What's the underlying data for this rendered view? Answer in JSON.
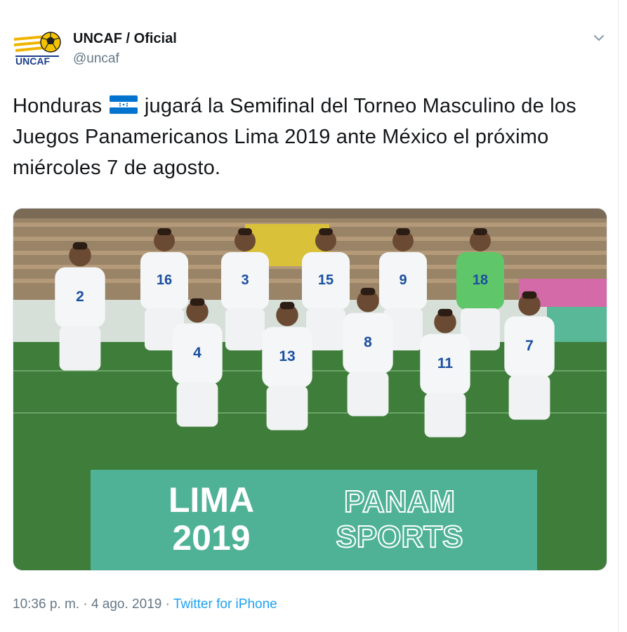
{
  "tweet": {
    "author_name": "UNCAF / Oficial",
    "author_handle": "@uncaf",
    "logo_text": "UNCAF",
    "text_before_flag": "Honduras",
    "text_after_flag": "jugará la Semifinal del Torneo Masculino de los Juegos Panamericanos Lima 2019 ante México el próximo miércoles 7 de agosto.",
    "time": "10:36 p. m.",
    "separator": "·",
    "date": "4 ago. 2019",
    "source": "Twitter for iPhone"
  },
  "photo": {
    "banner_left_line1": "LIMA",
    "banner_left_line2": "2019",
    "banner_right_line1": "PANAM",
    "banner_right_line2": "SPORTS",
    "shirt_numbers_back": [
      "16",
      "3",
      "15",
      "9",
      "18"
    ],
    "shirt_numbers_front": [
      "2",
      "4",
      "13",
      "8",
      "11",
      "7"
    ]
  },
  "colors": {
    "accent": "#1da1f2",
    "banner": "#4fb296",
    "pitch": "#3f7d3a",
    "flag_blue": "#0073cf"
  }
}
